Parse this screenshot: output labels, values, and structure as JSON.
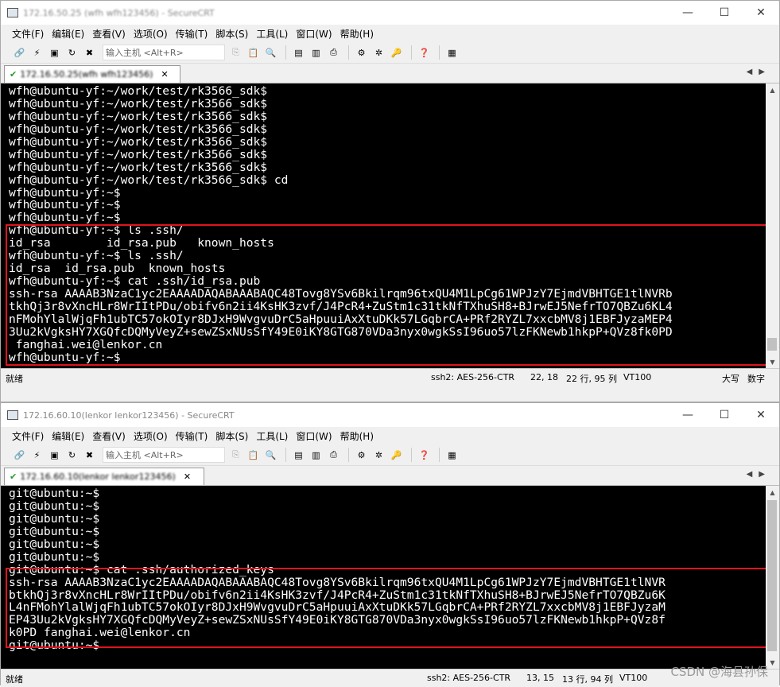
{
  "windows": [
    {
      "title": "172.16.50.25 (wfh  wfh123456) - SecureCRT",
      "menu": [
        "文件(F)",
        "编辑(E)",
        "查看(V)",
        "选项(O)",
        "传输(T)",
        "脚本(S)",
        "工具(L)",
        "窗口(W)",
        "帮助(H)"
      ],
      "host_placeholder": "输入主机 <Alt+R>",
      "tab_label": "172.16.50.25(wfh wfh123456)",
      "lines": [
        "wfh@ubuntu-yf:~/work/test/rk3566_sdk$",
        "wfh@ubuntu-yf:~/work/test/rk3566_sdk$",
        "wfh@ubuntu-yf:~/work/test/rk3566_sdk$",
        "wfh@ubuntu-yf:~/work/test/rk3566_sdk$",
        "wfh@ubuntu-yf:~/work/test/rk3566_sdk$",
        "wfh@ubuntu-yf:~/work/test/rk3566_sdk$",
        "wfh@ubuntu-yf:~/work/test/rk3566_sdk$",
        "wfh@ubuntu-yf:~/work/test/rk3566_sdk$ cd",
        "wfh@ubuntu-yf:~$",
        "wfh@ubuntu-yf:~$",
        "wfh@ubuntu-yf:~$",
        "wfh@ubuntu-yf:~$ ls .ssh/",
        "id_rsa        id_rsa.pub   known_hosts",
        "wfh@ubuntu-yf:~$ ls .ssh/",
        "id_rsa  id_rsa.pub  known_hosts",
        "wfh@ubuntu-yf:~$ cat .ssh/id_rsa.pub",
        "ssh-rsa AAAAB3NzaC1yc2EAAAADAQABAAABAQC48Tovg8YSv6Bkilrqm96txQU4M1LpCg61WPJzY7EjmdVBHTGE1tlNVRb",
        "tkhQj3r8vXncHLr8WrIItPDu/obifv6n2ii4KsHK3zvf/J4PcR4+ZuStm1c31tkNfTXhuSH8+BJrwEJ5NefrTO7QBZu6KL4",
        "nFMohYlalWjqFh1ubTC57okOIyr8DJxH9WvgvuDrC5aHpuuiAxXtuDKk57LGqbrCA+PRf2RYZL7xxcbMV8j1EBFJyzaMEP4",
        "3Uu2kVgksHY7XGQfcDQMyVeyZ+sewZSxNUsSfY49E0iKY8GTG870VDa3nyx0wgkSsI96uo57lzFKNewb1hkpP+QVz8fk0PD",
        " fanghai.wei@lenkor.cn",
        "wfh@ubuntu-yf:~$"
      ],
      "status": {
        "ready": "就绪",
        "cipher": "ssh2: AES-256-CTR",
        "pos": "22,  18",
        "rowcol": "22 行, 95 列",
        "term": "VT100",
        "caps": "大写",
        "num": "数字"
      }
    },
    {
      "title": "172.16.60.10(lenkor  lenkor123456) - SecureCRT",
      "menu": [
        "文件(F)",
        "编辑(E)",
        "查看(V)",
        "选项(O)",
        "传输(T)",
        "脚本(S)",
        "工具(L)",
        "窗口(W)",
        "帮助(H)"
      ],
      "host_placeholder": "输入主机 <Alt+R>",
      "tab_label": "172.16.60.10(lenkor lenkor123456)",
      "lines": [
        "git@ubuntu:~$",
        "git@ubuntu:~$",
        "git@ubuntu:~$",
        "git@ubuntu:~$",
        "git@ubuntu:~$",
        "git@ubuntu:~$",
        "git@ubuntu:~$ cat .ssh/authorized_keys",
        "ssh-rsa AAAAB3NzaC1yc2EAAAADAQABAAABAQC48Tovg8YSv6Bkilrqm96txQU4M1LpCg61WPJzY7EjmdVBHTGE1tlNVR",
        "btkhQj3r8vXncHLr8WrIItPDu/obifv6n2ii4KsHK3zvf/J4PcR4+ZuStm1c31tkNfTXhuSH8+BJrwEJ5NefrTO7QBZu6K",
        "L4nFMohYlalWjqFh1ubTC57okOIyr8DJxH9WvgvuDrC5aHpuuiAxXtuDKk57LGqbrCA+PRf2RYZL7xxcbMV8j1EBFJyzaM",
        "EP43Uu2kVgksHY7XGQfcDQMyVeyZ+sewZSxNUsSfY49E0iKY8GTG870VDa3nyx0wgkSsI96uo57lzFKNewb1hkpP+QVz8f",
        "k0PD fanghai.wei@lenkor.cn",
        "git@ubuntu:~$"
      ],
      "status": {
        "ready": "就绪",
        "cipher": "ssh2: AES-256-CTR",
        "pos": "13,  15",
        "rowcol": "13 行, 94 列",
        "term": "VT100"
      }
    }
  ],
  "watermark": "CSDN @海县孙保",
  "accent": {
    "highlight_border": "#e0141e",
    "terminal_bg": "#000000",
    "terminal_fg": "#ffffff"
  }
}
